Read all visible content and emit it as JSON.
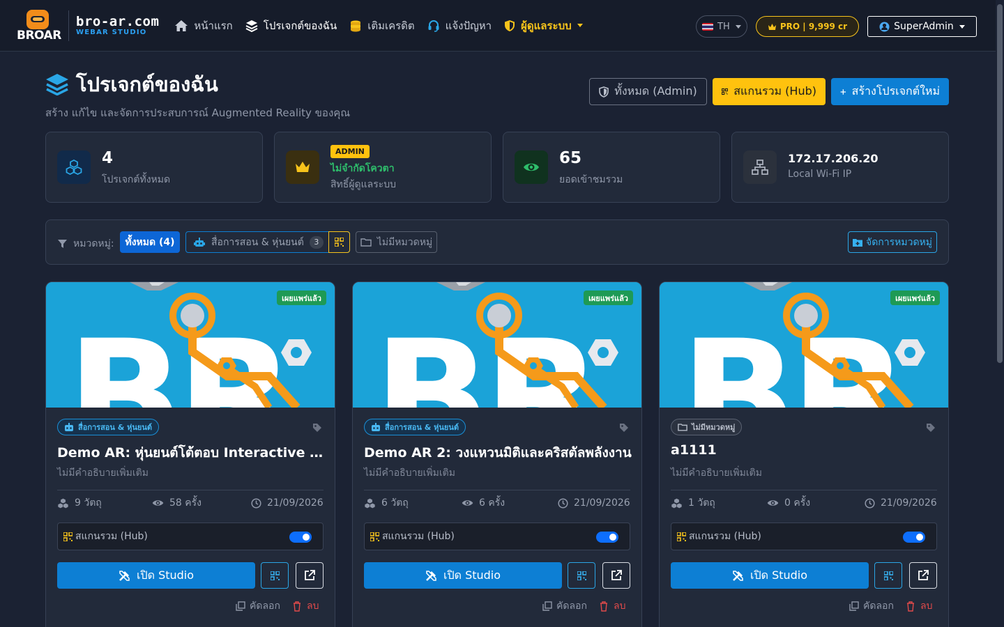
{
  "brand": {
    "logo_text": "BROAR",
    "domain": "bro-ar.com",
    "tagline": "WEBAR STUDIO"
  },
  "nav": {
    "items": [
      {
        "label": "หน้าแรก",
        "icon": "home-icon"
      },
      {
        "label": "โปรเจกต์ของฉัน",
        "icon": "layers-icon"
      },
      {
        "label": "เติมเครดิต",
        "icon": "coins-icon"
      },
      {
        "label": "แจ้งปัญหา",
        "icon": "headset-icon"
      },
      {
        "label": "ผู้ดูแลระบบ",
        "icon": "shield-icon"
      }
    ],
    "lang": "TH",
    "pro_badge": "PRO | 9,999 cr",
    "user": "SuperAdmin"
  },
  "header": {
    "title": "โปรเจกต์ของฉัน",
    "subtitle": "สร้าง แก้ไข และจัดการประสบการณ์ Augmented Reality ของคุณ",
    "btn_all": "ทั้งหมด (Admin)",
    "btn_hub": "สแกนรวม (Hub)",
    "btn_new": "สร้างโปรเจกต์ใหม่"
  },
  "stats": {
    "projects": {
      "value": "4",
      "label": "โปรเจกต์ทั้งหมด"
    },
    "quota": {
      "badge": "ADMIN",
      "value": "ไม่จำกัดโควตา",
      "label": "สิทธิ์ผู้ดูแลระบบ"
    },
    "views": {
      "value": "65",
      "label": "ยอดเข้าชมรวม"
    },
    "ip": {
      "value": "172.17.206.20",
      "label": "Local Wi-Fi IP"
    }
  },
  "filter": {
    "label": "หมวดหมู่:",
    "all": "ทั้งหมด (4)",
    "category": "สื่อการสอน & หุ่นยนต์",
    "category_count": "3",
    "uncategorized": "ไม่มีหมวดหมู่",
    "manage": "จัดการหมวดหมู่"
  },
  "colors": {
    "accent_blue": "#0d7fd4",
    "accent_yellow": "#ffc20e",
    "published_green": "#1e9a55",
    "danger_red": "#e04a4a"
  },
  "cards": [
    {
      "status": "เผยแพร่แล้ว",
      "category": "สื่อการสอน & หุ่นยนต์",
      "title": "Demo AR: หุ่นยนต์โต้ตอบ Interactive Robot",
      "desc": "ไม่มีคำอธิบายเพิ่มเติม",
      "objects": "9 วัตถุ",
      "views": "58 ครั้ง",
      "date": "21/09/2026",
      "hub_label": "สแกนรวม (Hub)",
      "studio": "เปิด Studio",
      "copy": "คัดลอก",
      "delete": "ลบ"
    },
    {
      "status": "เผยแพร่แล้ว",
      "category": "สื่อการสอน & หุ่นยนต์",
      "title": "Demo AR 2: วงแหวนมิติและคริสตัลพลังงาน",
      "desc": "ไม่มีคำอธิบายเพิ่มเติม",
      "objects": "6 วัตถุ",
      "views": "6 ครั้ง",
      "date": "21/09/2026",
      "hub_label": "สแกนรวม (Hub)",
      "studio": "เปิด Studio",
      "copy": "คัดลอก",
      "delete": "ลบ"
    },
    {
      "status": "เผยแพร่แล้ว",
      "category": "ไม่มีหมวดหมู่",
      "title": "a1111",
      "desc": "ไม่มีคำอธิบายเพิ่มเติม",
      "objects": "1 วัตถุ",
      "views": "0 ครั้ง",
      "date": "21/09/2026",
      "hub_label": "สแกนรวม (Hub)",
      "studio": "เปิด Studio",
      "copy": "คัดลอก",
      "delete": "ลบ"
    }
  ]
}
